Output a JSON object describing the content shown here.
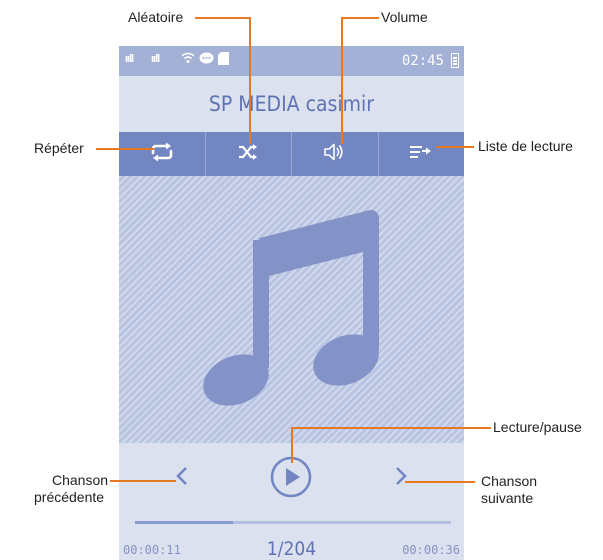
{
  "status_bar": {
    "time": "02:45",
    "signal_1": "ııll",
    "signal_2": "ııll"
  },
  "player": {
    "title": "SP MEDIA casimir",
    "elapsed": "00:00:11",
    "total": "00:00:36",
    "track_counter": "1/204",
    "progress": 0.31
  },
  "toolbar": [
    "repeat-icon",
    "shuffle-icon",
    "volume-icon",
    "playlist-icon"
  ],
  "callouts": {
    "shuffle": "Aléatoire",
    "volume": "Volume",
    "repeat": "Répéter",
    "playlist": "Liste de lecture",
    "play_pause": "Lecture/pause",
    "prev_line1": "Chanson",
    "prev_line2": "précédente",
    "next_line1": "Chanson",
    "next_line2": "suivante"
  },
  "colors": {
    "accent": "#e87722",
    "bar": "#7286c2",
    "status": "#a4b1d6",
    "screen": "#dbe1ef"
  }
}
